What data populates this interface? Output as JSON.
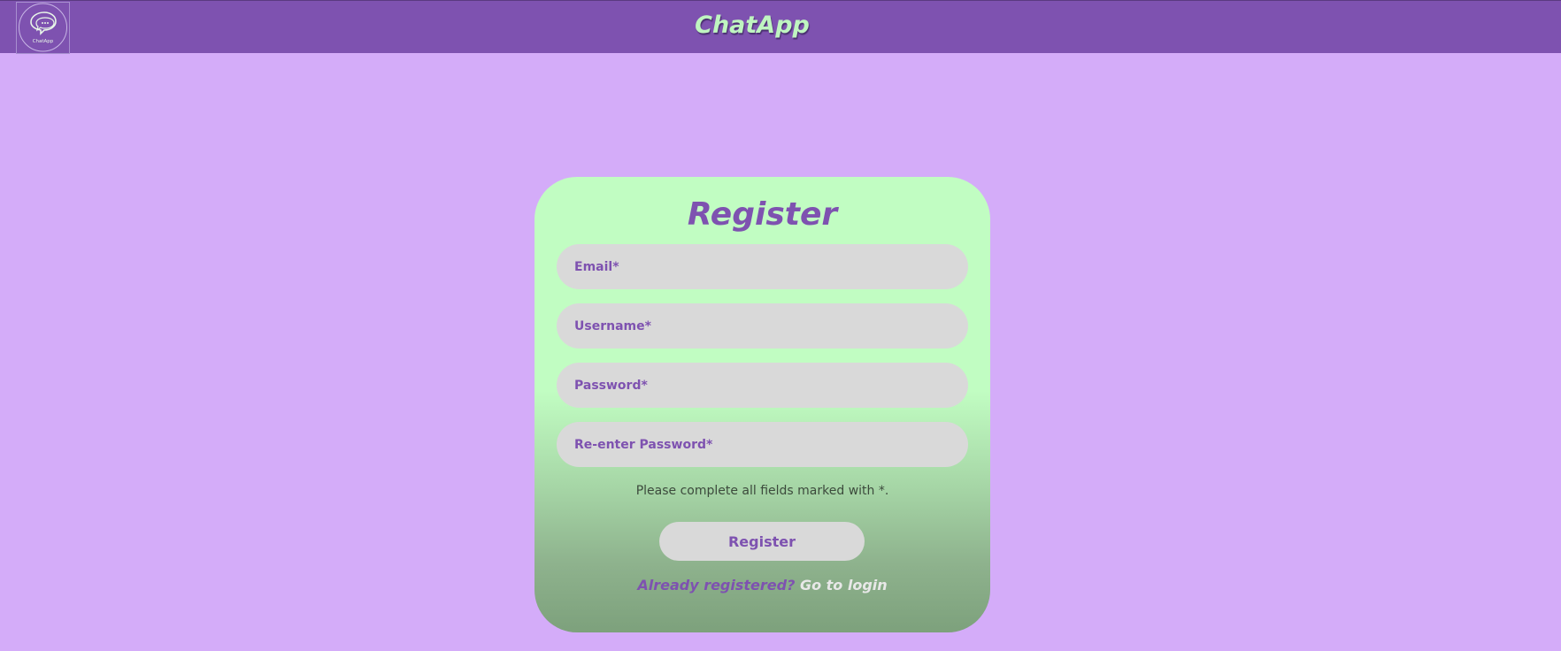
{
  "header": {
    "title": "ChatApp",
    "logo_text": "ChatApp",
    "logo_icon": "chat-bubbles-icon"
  },
  "form": {
    "title": "Register",
    "fields": [
      {
        "name": "email",
        "placeholder": "Email*",
        "value": ""
      },
      {
        "name": "username",
        "placeholder": "Username*",
        "value": ""
      },
      {
        "name": "password",
        "placeholder": "Password*",
        "value": ""
      },
      {
        "name": "reenter_password",
        "placeholder": "Re-enter Password*",
        "value": ""
      }
    ],
    "hint": "Please complete all fields marked with *.",
    "submit_label": "Register",
    "already_text": "Already registered?",
    "login_link": "Go to login"
  },
  "colors": {
    "background": "#d4acf9",
    "header": "#7e52b0",
    "accent": "#7e52b0",
    "card_top": "#c1fdc2",
    "card_bottom": "#7da17c",
    "input_bg": "#d9d9d9"
  }
}
